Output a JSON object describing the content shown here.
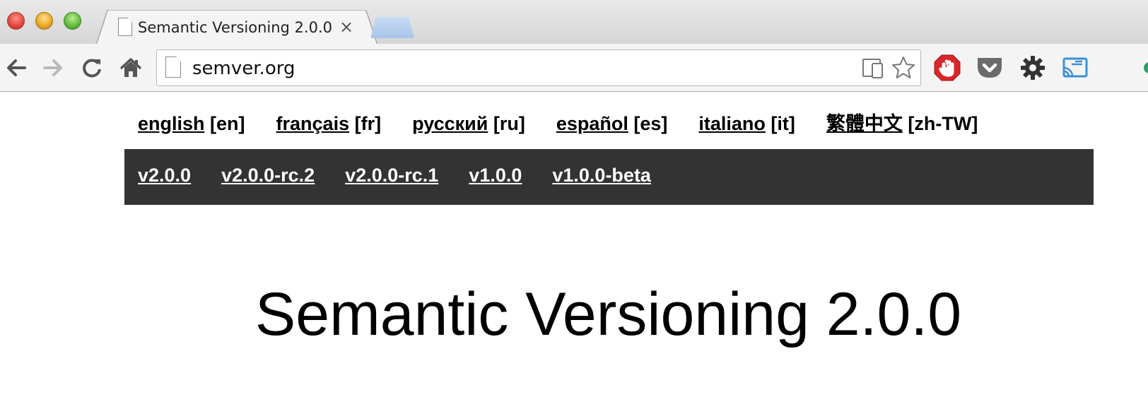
{
  "browser": {
    "tab_title": "Semantic Versioning 2.0.0",
    "tab_close": "×",
    "url": "semver.org",
    "new_tab_color": "#a9c4ea"
  },
  "toolbar_icons": [
    "back-icon",
    "forward-icon",
    "reload-icon",
    "home-icon"
  ],
  "omnibox_icons": [
    "device-mode-icon",
    "bookmark-star-icon"
  ],
  "extensions": [
    "adblock-icon",
    "pocket-icon",
    "settings-gear-icon",
    "cast-icon"
  ],
  "languages": [
    {
      "name": "english",
      "code": "[en]"
    },
    {
      "name": "français",
      "code": "[fr]"
    },
    {
      "name": "русский",
      "code": "[ru]"
    },
    {
      "name": "español",
      "code": "[es]"
    },
    {
      "name": "italiano",
      "code": "[it]"
    },
    {
      "name": "繁體中文",
      "code": "[zh-TW]"
    }
  ],
  "versions": [
    "v2.0.0",
    "v2.0.0-rc.2",
    "v2.0.0-rc.1",
    "v1.0.0",
    "v1.0.0-beta"
  ],
  "page_title": "Semantic Versioning 2.0.0",
  "colors": {
    "version_bar_bg": "#333333",
    "adblock_red": "#d9262a",
    "pocket_gray": "#6b6b6b"
  }
}
